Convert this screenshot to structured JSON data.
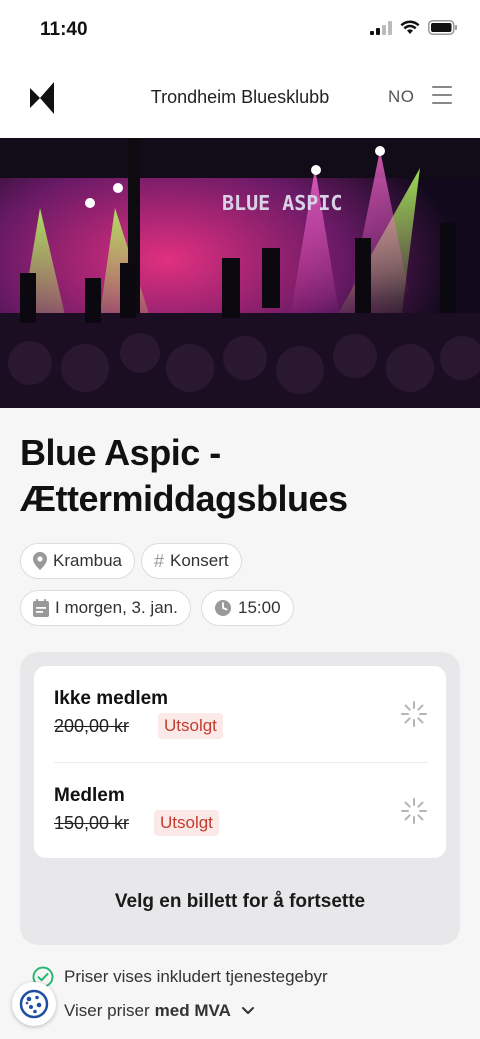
{
  "status": {
    "time": "11:40"
  },
  "nav": {
    "title": "Trondheim Bluesklubb",
    "language": "NO"
  },
  "event": {
    "title_line1": "Blue Aspic -",
    "title_line2": "Ættermiddagsblues",
    "venue": "Krambua",
    "category": "Konsert",
    "date": "I morgen, 3. jan.",
    "time": "15:00",
    "hero_sign": "BLUE ASPIC"
  },
  "tickets": [
    {
      "name": "Ikke medlem",
      "price": "200,00 kr",
      "status": "Utsolgt"
    },
    {
      "name": "Medlem",
      "price": "150,00 kr",
      "status": "Utsolgt"
    }
  ],
  "continue_label": "Velg en billett for å fortsette",
  "info": {
    "fee_note": "Priser vises inkludert tjenestegebyr",
    "vat_prefix": "Viser priser",
    "vat_value": "med MVA"
  },
  "colors": {
    "accent_green": "#2bb673",
    "sold_red": "#c43c2f",
    "sold_bg": "#fbe9e7"
  }
}
